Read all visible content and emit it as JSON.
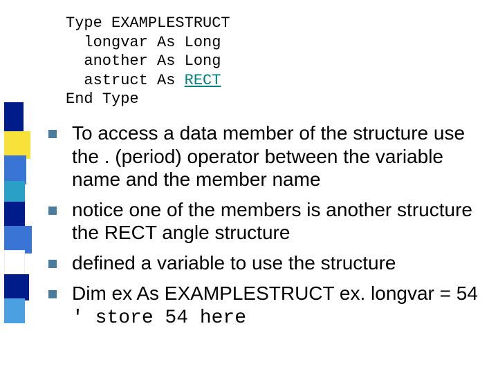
{
  "code": {
    "l1": "Type EXAMPLESTRUCT",
    "l2": "  longvar As Long",
    "l3": "  another As Long",
    "l4a": "  astruct As ",
    "l4link": "RECT",
    "l5": "End Type"
  },
  "bullets": {
    "b1": "To access a data member of the structure use the . (period) operator between the variable name and the member name",
    "b2": " notice one of the members is another structure the RECT angle structure",
    "b3": "defined a variable to use the structure",
    "b4a": "Dim ex As EXAMPLESTRUCT   ex. longvar = 54  ",
    "b4b": "' store 54 here"
  }
}
